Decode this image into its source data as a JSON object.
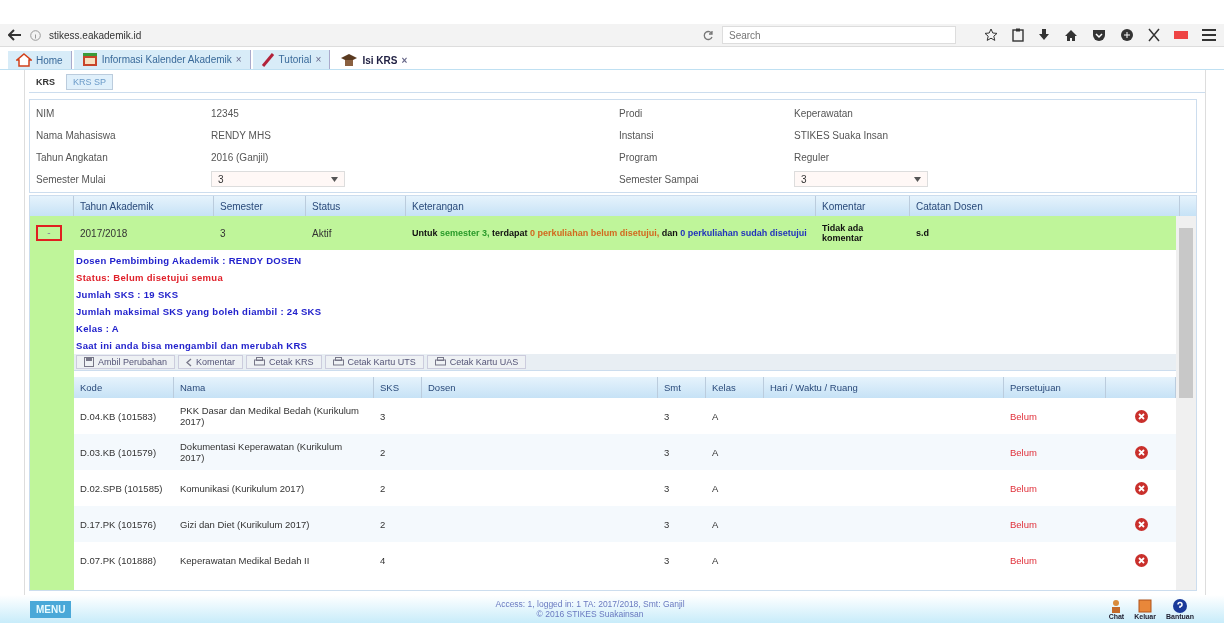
{
  "browser": {
    "url": "stikess.eakademik.id",
    "search_placeholder": "Search"
  },
  "app_tabs": [
    {
      "label": "Home",
      "selected": false
    },
    {
      "label": "Informasi Kalender Akademik",
      "selected": false,
      "close": "×"
    },
    {
      "label": "Tutorial",
      "selected": false,
      "close": "×"
    },
    {
      "label": "Isi KRS",
      "selected": true,
      "close": "×"
    }
  ],
  "sub_tabs": [
    {
      "label": "KRS",
      "selected": true
    },
    {
      "label": "KRS SP",
      "selected": false
    }
  ],
  "info_left": [
    {
      "label": "NIM",
      "value": "12345"
    },
    {
      "label": "Nama Mahasiswa",
      "value": "RENDY MHS"
    },
    {
      "label": "Tahun Angkatan",
      "value": "2016 (Ganjil)"
    },
    {
      "label": "Semester Mulai",
      "select": "3"
    }
  ],
  "info_right": [
    {
      "label": "Prodi",
      "value": "Keperawatan"
    },
    {
      "label": "Instansi",
      "value": "STIKES Suaka Insan"
    },
    {
      "label": "Program",
      "value": "Reguler"
    },
    {
      "label": "Semester Sampai",
      "select": "3"
    }
  ],
  "grid": {
    "columns": [
      "Tahun Akademik",
      "Semester",
      "Status",
      "Keterangan",
      "Komentar",
      "Catatan Dosen"
    ],
    "row": {
      "expanded": true,
      "expander": "-",
      "tahun": "2017/2018",
      "semester": "3",
      "status": "Aktif",
      "keterangan": [
        {
          "kind": "plain",
          "text": "Untuk"
        },
        {
          "kind": "green",
          "text": "semester 3,"
        },
        {
          "kind": "plain",
          "text": "terdapat"
        },
        {
          "kind": "orange",
          "text": "0 perkuliahan belum disetujui,"
        },
        {
          "kind": "plain",
          "text": "dan"
        },
        {
          "kind": "blue",
          "text": "0 perkuliahan sudah disetujui"
        }
      ],
      "komentar": "Tidak ada komentar",
      "catatan": "s.d"
    }
  },
  "details": [
    {
      "kind": "info",
      "text": "Dosen Pembimbing Akademik : RENDY DOSEN"
    },
    {
      "kind": "alert",
      "text": "Status: Belum disetujui semua"
    },
    {
      "kind": "info",
      "text": "Jumlah SKS : 19 SKS"
    },
    {
      "kind": "info",
      "text": "Jumlah maksimal SKS yang boleh diambil : 24 SKS"
    },
    {
      "kind": "info",
      "text": "Kelas : A"
    },
    {
      "kind": "info",
      "text": "Saat ini anda bisa mengambil dan merubah KRS"
    }
  ],
  "actions": [
    "Ambil Perubahan",
    "Komentar",
    "Cetak KRS",
    "Cetak Kartu UTS",
    "Cetak Kartu UAS"
  ],
  "courses": {
    "columns": [
      "Kode",
      "Nama",
      "SKS",
      "Dosen",
      "Smt",
      "Kelas",
      "Hari / Waktu / Ruang",
      "Persetujuan"
    ],
    "rows": [
      {
        "kode": "D.04.KB (101583)",
        "nama": "PKK Dasar dan Medikal Bedah (Kurikulum 2017)",
        "sks": "3",
        "smt": "3",
        "kelas": "A",
        "persetujuan": "Belum"
      },
      {
        "kode": "D.03.KB (101579)",
        "nama": "Dokumentasi Keperawatan (Kurikulum 2017)",
        "sks": "2",
        "smt": "3",
        "kelas": "A",
        "persetujuan": "Belum"
      },
      {
        "kode": "D.02.SPB (101585)",
        "nama": "Komunikasi (Kurikulum 2017)",
        "sks": "2",
        "smt": "3",
        "kelas": "A",
        "persetujuan": "Belum"
      },
      {
        "kode": "D.17.PK (101576)",
        "nama": "Gizi dan Diet (Kurikulum 2017)",
        "sks": "2",
        "smt": "3",
        "kelas": "A",
        "persetujuan": "Belum"
      },
      {
        "kode": "D.07.PK (101888)",
        "nama": "Keperawatan Medikal Bedah II",
        "sks": "4",
        "smt": "3",
        "kelas": "A",
        "persetujuan": "Belum"
      }
    ]
  },
  "footer": {
    "menu": "MENU",
    "status": "Access: 1, logged in: 1 TA: 2017/2018, Smt: Ganjil",
    "copyright": "© 2016 STIKES Suakainsan",
    "links": [
      "Chat",
      "Keluar",
      "Bantuan"
    ]
  }
}
